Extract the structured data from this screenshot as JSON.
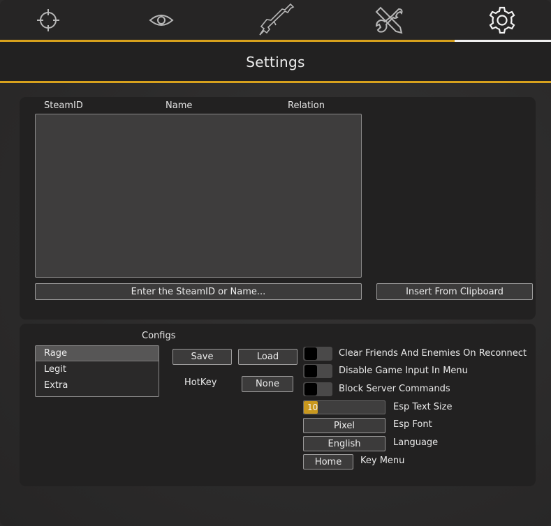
{
  "tabs": [
    {
      "icon": "crosshair-icon",
      "active": false
    },
    {
      "icon": "eye-icon",
      "active": false
    },
    {
      "icon": "rifle-icon",
      "active": false
    },
    {
      "icon": "wrench-screwdriver-icon",
      "active": false
    },
    {
      "icon": "gear-icon",
      "active": true
    }
  ],
  "title": "Settings",
  "friends": {
    "columns": [
      "SteamID",
      "Name",
      "Relation"
    ],
    "rows": [],
    "input_label": "Enter the SteamID or Name...",
    "clipboard_button": "Insert From Clipboard"
  },
  "configs": {
    "heading": "Configs",
    "items": [
      "Rage",
      "Legit",
      "Extra"
    ],
    "selected": "Rage",
    "save_label": "Save",
    "load_label": "Load",
    "hotkey_label": "HotKey",
    "hotkey_value": "None"
  },
  "options": {
    "clear_on_reconnect": {
      "label": "Clear Friends And Enemies On Reconnect",
      "enabled": false
    },
    "disable_game_input": {
      "label": "Disable Game Input In Menu",
      "enabled": false
    },
    "block_server_commands": {
      "label": "Block Server Commands",
      "enabled": false
    },
    "esp_text_size": {
      "label": "Esp Text Size",
      "value": "10"
    },
    "esp_font": {
      "label": "Esp Font",
      "value": "Pixel"
    },
    "language": {
      "label": "Language",
      "value": "English"
    },
    "key_menu": {
      "label": "Key Menu",
      "value": "Home"
    }
  },
  "colors": {
    "accent": "#d7a11d",
    "active_tab_underline": "#f0f0f0",
    "panel": "#222121",
    "background": "#2b2a2a"
  }
}
